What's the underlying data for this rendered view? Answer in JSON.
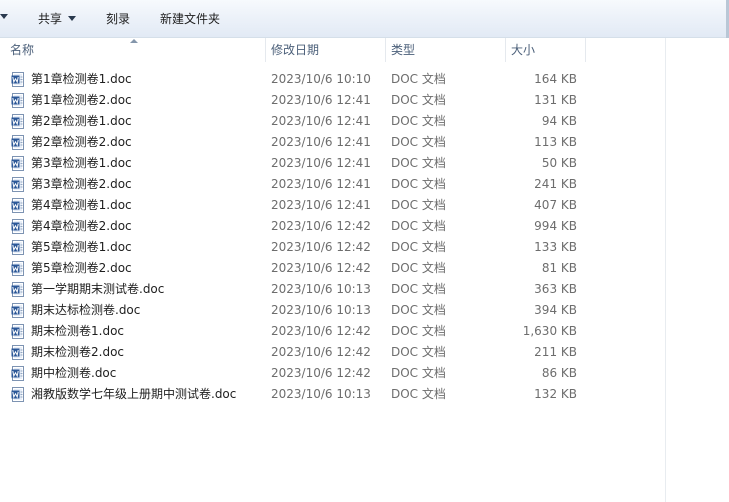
{
  "toolbar": {
    "share_label": "共享",
    "burn_label": "刻录",
    "new_folder_label": "新建文件夹"
  },
  "columns": {
    "name": "名称",
    "date": "修改日期",
    "type": "类型",
    "size": "大小"
  },
  "files": [
    {
      "name": "第1章检测卷1.doc",
      "date": "2023/10/6 10:10",
      "type": "DOC 文档",
      "size": "164 KB"
    },
    {
      "name": "第1章检测卷2.doc",
      "date": "2023/10/6 12:41",
      "type": "DOC 文档",
      "size": "131 KB"
    },
    {
      "name": "第2章检测卷1.doc",
      "date": "2023/10/6 12:41",
      "type": "DOC 文档",
      "size": "94 KB"
    },
    {
      "name": "第2章检测卷2.doc",
      "date": "2023/10/6 12:41",
      "type": "DOC 文档",
      "size": "113 KB"
    },
    {
      "name": "第3章检测卷1.doc",
      "date": "2023/10/6 12:41",
      "type": "DOC 文档",
      "size": "50 KB"
    },
    {
      "name": "第3章检测卷2.doc",
      "date": "2023/10/6 12:41",
      "type": "DOC 文档",
      "size": "241 KB"
    },
    {
      "name": "第4章检测卷1.doc",
      "date": "2023/10/6 12:41",
      "type": "DOC 文档",
      "size": "407 KB"
    },
    {
      "name": "第4章检测卷2.doc",
      "date": "2023/10/6 12:42",
      "type": "DOC 文档",
      "size": "994 KB"
    },
    {
      "name": "第5章检测卷1.doc",
      "date": "2023/10/6 12:42",
      "type": "DOC 文档",
      "size": "133 KB"
    },
    {
      "name": "第5章检测卷2.doc",
      "date": "2023/10/6 12:42",
      "type": "DOC 文档",
      "size": "81 KB"
    },
    {
      "name": "第一学期期末测试卷.doc",
      "date": "2023/10/6 10:13",
      "type": "DOC 文档",
      "size": "363 KB"
    },
    {
      "name": "期末达标检测卷.doc",
      "date": "2023/10/6 10:13",
      "type": "DOC 文档",
      "size": "394 KB"
    },
    {
      "name": "期末检测卷1.doc",
      "date": "2023/10/6 12:42",
      "type": "DOC 文档",
      "size": "1,630 KB"
    },
    {
      "name": "期末检测卷2.doc",
      "date": "2023/10/6 12:42",
      "type": "DOC 文档",
      "size": "211 KB"
    },
    {
      "name": "期中检测卷.doc",
      "date": "2023/10/6 12:42",
      "type": "DOC 文档",
      "size": "86 KB"
    },
    {
      "name": "湘教版数学七年级上册期中测试卷.doc",
      "date": "2023/10/6 10:13",
      "type": "DOC 文档",
      "size": "132 KB"
    }
  ],
  "icons": {
    "file": "word-doc-icon",
    "share_dropdown": "chevron-down-icon",
    "sort": "sort-ascending-icon"
  },
  "colors": {
    "doc_icon_blue": "#2b5797",
    "header_text": "#4c607a",
    "secondary_text": "#6d6d6d"
  }
}
